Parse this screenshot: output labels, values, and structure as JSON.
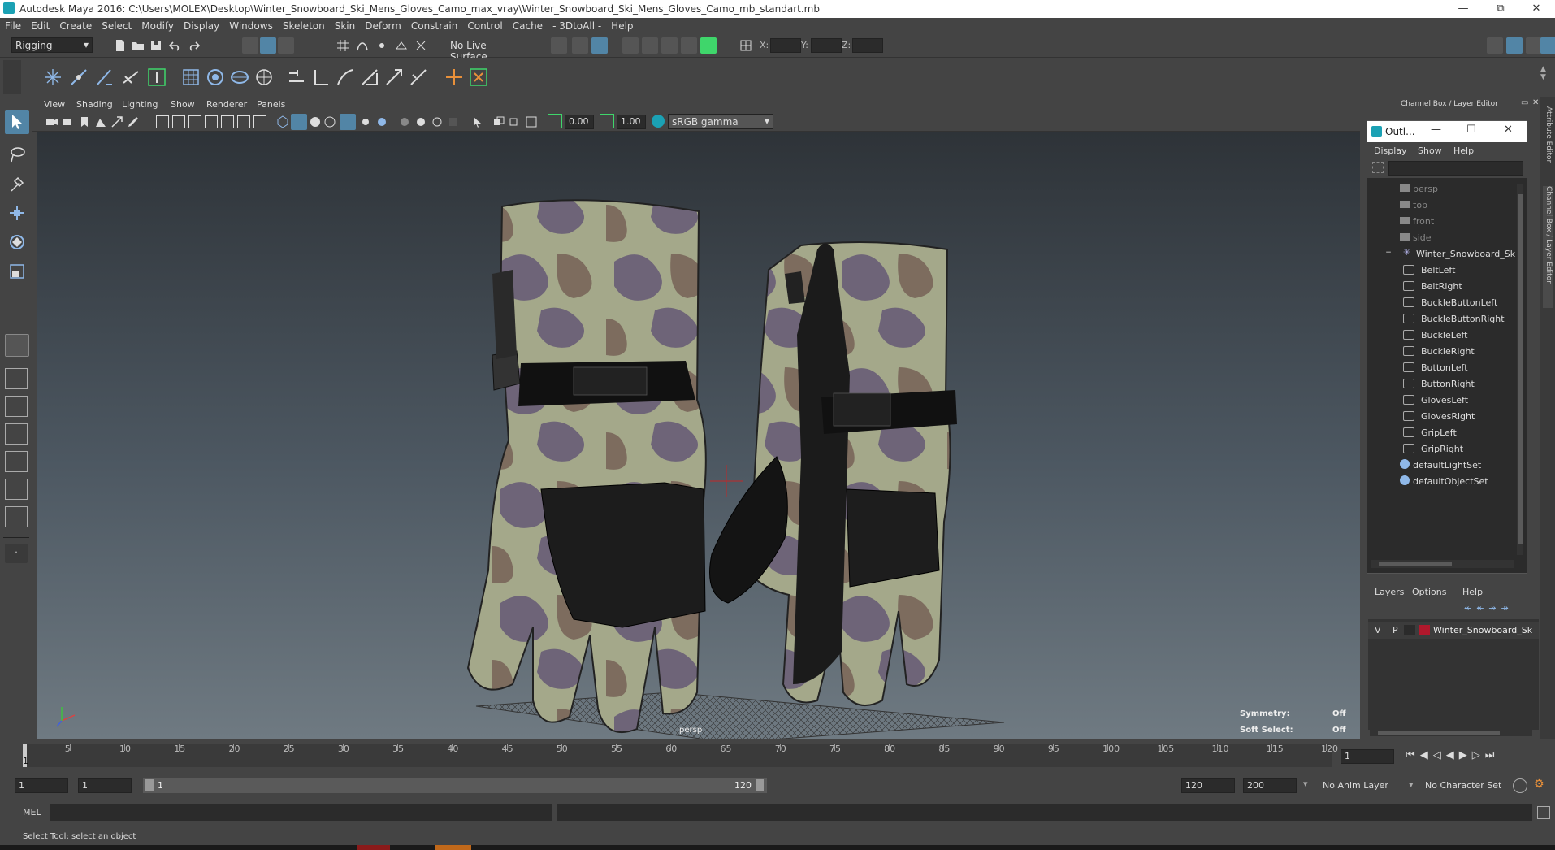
{
  "window": {
    "title": "Autodesk Maya 2016: C:\\Users\\MOLEX\\Desktop\\Winter_Snowboard_Ski_Mens_Gloves_Camo_max_vray\\Winter_Snowboard_Ski_Mens_Gloves_Camo_mb_standart.mb"
  },
  "menu": [
    "File",
    "Edit",
    "Create",
    "Select",
    "Modify",
    "Display",
    "Windows",
    "Skeleton",
    "Skin",
    "Deform",
    "Constrain",
    "Control",
    "Cache",
    "- 3DtoAll -",
    "Help"
  ],
  "status": {
    "mode": "Rigging",
    "live_surface": "No Live Surface",
    "x_label": "X:",
    "y_label": "Y:",
    "z_label": "Z:"
  },
  "panel": {
    "menus": [
      "View",
      "Shading",
      "Lighting",
      "Show",
      "Renderer",
      "Panels"
    ],
    "exposure": "0.00",
    "gamma": "1.00",
    "color_space": "sRGB gamma",
    "camera_label": "persp",
    "symmetry_label": "Symmetry:",
    "symmetry_value": "Off",
    "soft_select_label": "Soft Select:",
    "soft_select_value": "Off"
  },
  "channel_box": {
    "title": "Channel Box / Layer Editor",
    "side_tab_attr": "Attribute Editor",
    "side_tab_cb": "Channel Box / Layer Editor"
  },
  "outliner": {
    "title": "Outl...",
    "menus": [
      "Display",
      "Show",
      "Help"
    ],
    "cameras": [
      "persp",
      "top",
      "front",
      "side"
    ],
    "group": "Winter_Snowboard_Ski",
    "children": [
      "BeltLeft",
      "BeltRight",
      "BuckleButtonLeft",
      "BuckleButtonRight",
      "BuckleLeft",
      "BuckleRight",
      "ButtonLeft",
      "ButtonRight",
      "GlovesLeft",
      "GlovesRight",
      "GripLeft",
      "GripRight"
    ],
    "sets": [
      "defaultLightSet",
      "defaultObjectSet"
    ]
  },
  "layers": {
    "menus": [
      "Layers",
      "Options",
      "Help"
    ],
    "v": "V",
    "p": "P",
    "layer_name": "Winter_Snowboard_Sk",
    "layer_color": "#b0182c"
  },
  "timeline": {
    "ticks": [
      "5",
      "10",
      "15",
      "20",
      "25",
      "30",
      "35",
      "40",
      "45",
      "50",
      "55",
      "60",
      "65",
      "70",
      "75",
      "80",
      "85",
      "90",
      "95",
      "100",
      "105",
      "110",
      "115",
      "120"
    ],
    "start_label": "1",
    "current_frame": "1"
  },
  "range": {
    "start": "1",
    "anim_start": "1",
    "slider_start": "1",
    "slider_end": "120",
    "anim_end": "120",
    "end": "200",
    "anim_layer": "No Anim Layer",
    "character_set": "No Character Set"
  },
  "command": {
    "label": "MEL"
  },
  "help": {
    "text": "Select Tool: select an object"
  },
  "colors": {
    "maya_teal": "#1ba1b4",
    "accent_blue": "#5285a6",
    "active_green": "#3fd66b"
  }
}
